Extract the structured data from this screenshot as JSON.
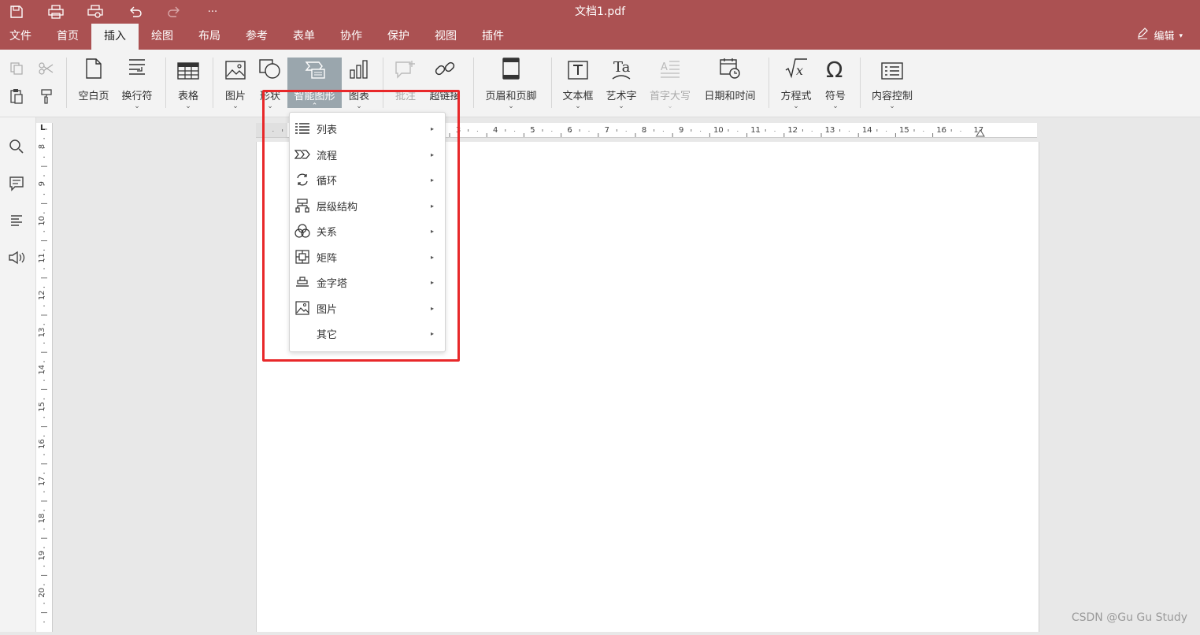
{
  "app": {
    "doc_title": "文档1.pdf",
    "brand_color": "#ab5152",
    "accent_highlight": "#e8282a"
  },
  "quick_access": [
    "save-icon",
    "print-icon",
    "print-preview-icon",
    "undo-icon",
    "redo-icon",
    "more-icon"
  ],
  "quick_more": "···",
  "menu": {
    "tabs": [
      "文件",
      "首页",
      "插入",
      "绘图",
      "布局",
      "参考",
      "表单",
      "协作",
      "保护",
      "视图",
      "插件"
    ],
    "active_tab": "插入",
    "edit_label": "编辑"
  },
  "ribbon": {
    "blank_page": "空白页",
    "line_break": "换行符",
    "table": "表格",
    "picture": "图片",
    "shape": "形状",
    "smartart": "智能图形",
    "chart": "图表",
    "comment": "批注",
    "hyperlink": "超链接",
    "header_footer": "页眉和页脚",
    "textbox": "文本框",
    "wordart": "艺术字",
    "dropcap": "首字大写",
    "datetime": "日期和时间",
    "equation": "方程式",
    "symbol": "符号",
    "content_control": "内容控制",
    "chevron": "⌄",
    "chevron_up": "⌃"
  },
  "smartart_menu": {
    "items": [
      "列表",
      "流程",
      "循环",
      "层级结构",
      "关系",
      "矩阵",
      "金字塔",
      "图片",
      "其它"
    ],
    "arrow": "▸"
  },
  "ruler": {
    "corner": "L",
    "h_numbers": [
      "3",
      "4",
      "5",
      "6",
      "7",
      "8",
      "9",
      "10",
      "11",
      "12",
      "13",
      "14",
      "15",
      "16",
      "17"
    ],
    "v_numbers": [
      "8",
      "9",
      "10",
      "11",
      "12",
      "13",
      "14",
      "15",
      "16",
      "17",
      "18",
      "19",
      "20"
    ]
  },
  "watermark": "CSDN @Gu Gu Study"
}
